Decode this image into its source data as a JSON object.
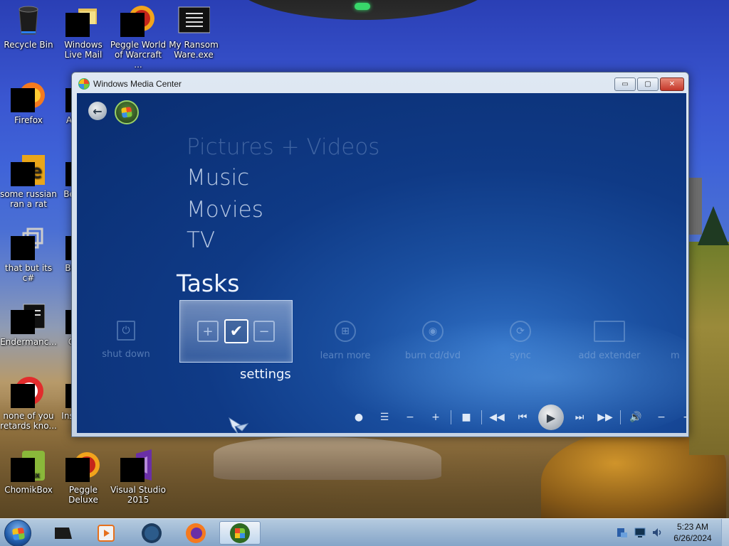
{
  "desktop": {
    "icons": [
      {
        "label": "Recycle Bin"
      },
      {
        "label": "Windows Live Mail"
      },
      {
        "label": "Peggle World of Warcraft ..."
      },
      {
        "label": "My Ransom Ware.exe"
      },
      {
        "label": "Firefox"
      },
      {
        "label": "A"
      },
      {
        "label": "some russian ran a rat"
      },
      {
        "label": "Be"
      },
      {
        "label": "that but its c#"
      },
      {
        "label": "Bi"
      },
      {
        "label": "Endermanc..."
      },
      {
        "label": "C"
      },
      {
        "label": "none of you retards kno..."
      },
      {
        "label": "Ins"
      },
      {
        "label": "ChomikBox"
      },
      {
        "label": "Peggle Deluxe"
      },
      {
        "label": "Visual Studio 2015"
      }
    ]
  },
  "window": {
    "title": "Windows Media Center",
    "minimize": "▭",
    "maximize": "▢",
    "close": "✕"
  },
  "media_center": {
    "menu": [
      "Pictures + Videos",
      "Music",
      "Movies",
      "TV"
    ],
    "tasks_title": "Tasks",
    "tasks": [
      {
        "label": "shut down",
        "icon": "power-icon"
      },
      {
        "label": "learn more",
        "icon": "windows-icon"
      },
      {
        "label": "burn cd/dvd",
        "icon": "disc-icon"
      },
      {
        "label": "sync",
        "icon": "sync-icon"
      },
      {
        "label": "add extender",
        "icon": "monitor-icon"
      },
      {
        "label": "m",
        "icon": "partial"
      }
    ],
    "settings_label": "settings",
    "settings_plus": "+",
    "settings_check": "✔",
    "settings_minus": "−"
  },
  "transport": {
    "record": "●",
    "list": "☰",
    "minus": "−",
    "plus": "+",
    "stop": "■",
    "rewind": "◀◀",
    "prev": "⏮",
    "play": "▶",
    "next": "⏭",
    "fast_forward": "▶▶",
    "volume": "🔊",
    "vol_down": "−",
    "vol_up": "+"
  },
  "taskbar": {
    "time": "5:23 AM",
    "date": "6/26/2024"
  },
  "colors": {
    "wmc_background": "#0f3a86",
    "taskbar": "#b4cce6",
    "accent_green": "#38d86a"
  }
}
